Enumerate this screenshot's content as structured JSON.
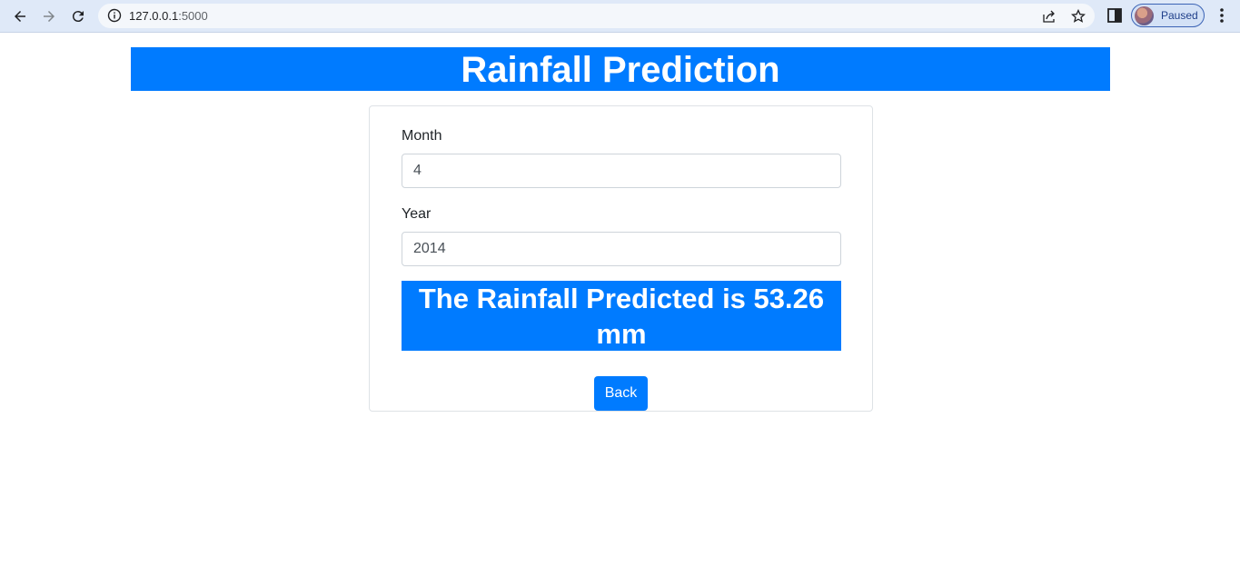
{
  "browser": {
    "url_host": "127.0.0.1",
    "url_port": ":5000",
    "profile_status": "Paused"
  },
  "page": {
    "title": "Rainfall Prediction",
    "form": {
      "month_label": "Month",
      "month_value": "4",
      "year_label": "Year",
      "year_value": "2014"
    },
    "result_text": "The Rainfall Predicted is 53.26 mm",
    "back_label": "Back"
  },
  "colors": {
    "primary": "#007bff",
    "toolbar_bg": "#dfe9f8"
  }
}
